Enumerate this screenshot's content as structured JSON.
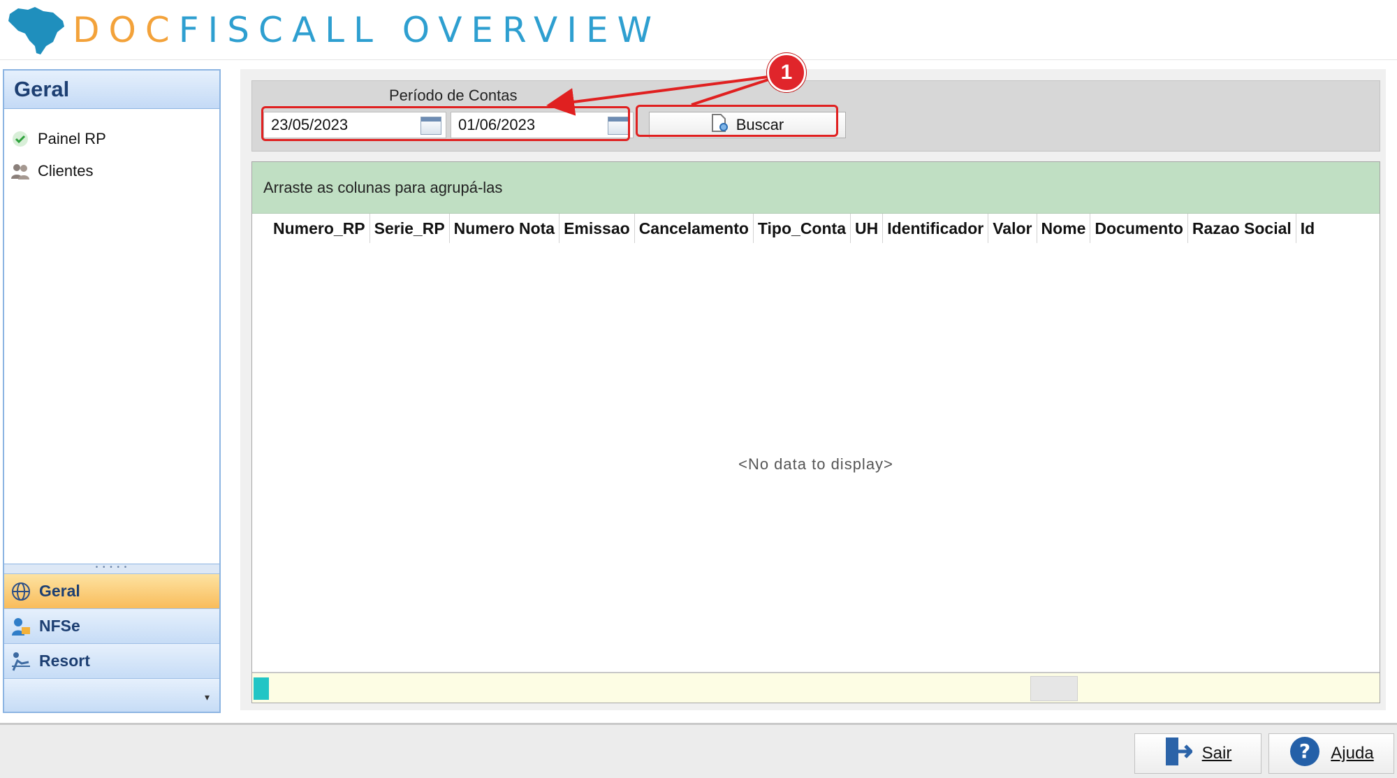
{
  "header": {
    "title_part1": "DOC",
    "title_part2": "FISCALL OVERVIEW",
    "logo_icon": "brazil-map-icon"
  },
  "sidebar": {
    "title": "Geral",
    "items": [
      {
        "label": "Painel RP",
        "icon": "check-icon"
      },
      {
        "label": "Clientes",
        "icon": "users-icon"
      }
    ],
    "nav": [
      {
        "label": "Geral",
        "icon": "globe-icon",
        "active": true
      },
      {
        "label": "NFSe",
        "icon": "user-folder-icon",
        "active": false
      },
      {
        "label": "Resort",
        "icon": "resort-icon",
        "active": false
      }
    ]
  },
  "filter": {
    "period_label": "Período de Contas",
    "date_from": "23/05/2023",
    "date_to": "01/06/2023",
    "search_label": "Buscar",
    "annotation_number": "1"
  },
  "grid": {
    "group_hint": "Arraste as colunas para agrupá-las",
    "columns": [
      "Numero_RP",
      "Serie_RP",
      "Numero Nota",
      "Emissao",
      "Cancelamento",
      "Tipo_Conta",
      "UH",
      "Identificador",
      "Valor",
      "Nome",
      "Documento",
      "Razao Social",
      "Id"
    ],
    "empty_text": "<No data to display>"
  },
  "footer": {
    "exit_label": "Sair",
    "help_label": "Ajuda"
  },
  "colors": {
    "accent_orange": "#f3a23a",
    "accent_blue": "#2e9fd0",
    "annotation_red": "#e02020",
    "group_panel": "#c0dfc3"
  }
}
